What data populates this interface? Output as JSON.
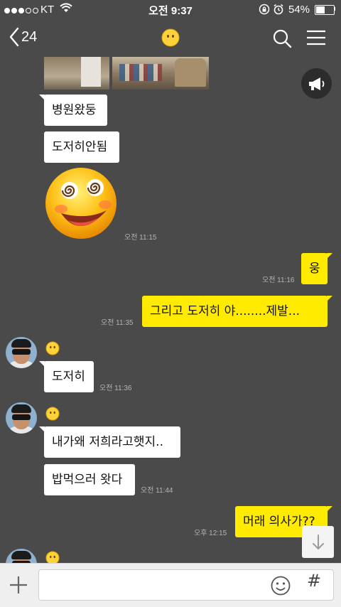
{
  "status_bar": {
    "carrier": "KT",
    "time": "오전 9:37",
    "battery_percent": "54%",
    "battery_level": 0.54,
    "signal_bars_filled": 3,
    "signal_bars_total": 5
  },
  "nav": {
    "back_count": "24",
    "back_icon": "chevron-left-icon",
    "title_icon": "neutral-face-emoji-icon",
    "search_icon": "search-icon",
    "menu_icon": "hamburger-menu-icon"
  },
  "notice_icon": "megaphone-icon",
  "messages": [
    {
      "text": "병원왔둥",
      "side": "left"
    },
    {
      "text": "도저히안됨",
      "side": "left"
    },
    {
      "sticker": "dizzy-smiley-emoticon",
      "timestamp": "오전 11:15",
      "side": "left"
    },
    {
      "text": "웅",
      "timestamp": "오전 11:16",
      "side": "right"
    },
    {
      "text": "그리고 도저히 야........제발...",
      "timestamp": "오전 11:35",
      "side": "right"
    },
    {
      "text": "도저히",
      "timestamp": "오전 11:36",
      "side": "left"
    },
    {
      "text": "내가왜 저희라고햇지..",
      "side": "left"
    },
    {
      "text": "밥먹으러 왓다",
      "timestamp": "오전 11:44",
      "side": "left"
    },
    {
      "text": "머래 의사가??",
      "timestamp": "오후 12:15",
      "side": "right"
    }
  ],
  "input": {
    "placeholder": "",
    "value": "",
    "plus_icon": "plus-icon",
    "emoticon_icon": "smiley-icon",
    "hash_label": "#"
  },
  "scroll_down_icon": "arrow-down-icon",
  "colors": {
    "background": "#4a4a4a",
    "my_bubble": "#ffeb00",
    "their_bubble": "#ffffff",
    "timestamp": "#b5b5b5"
  }
}
